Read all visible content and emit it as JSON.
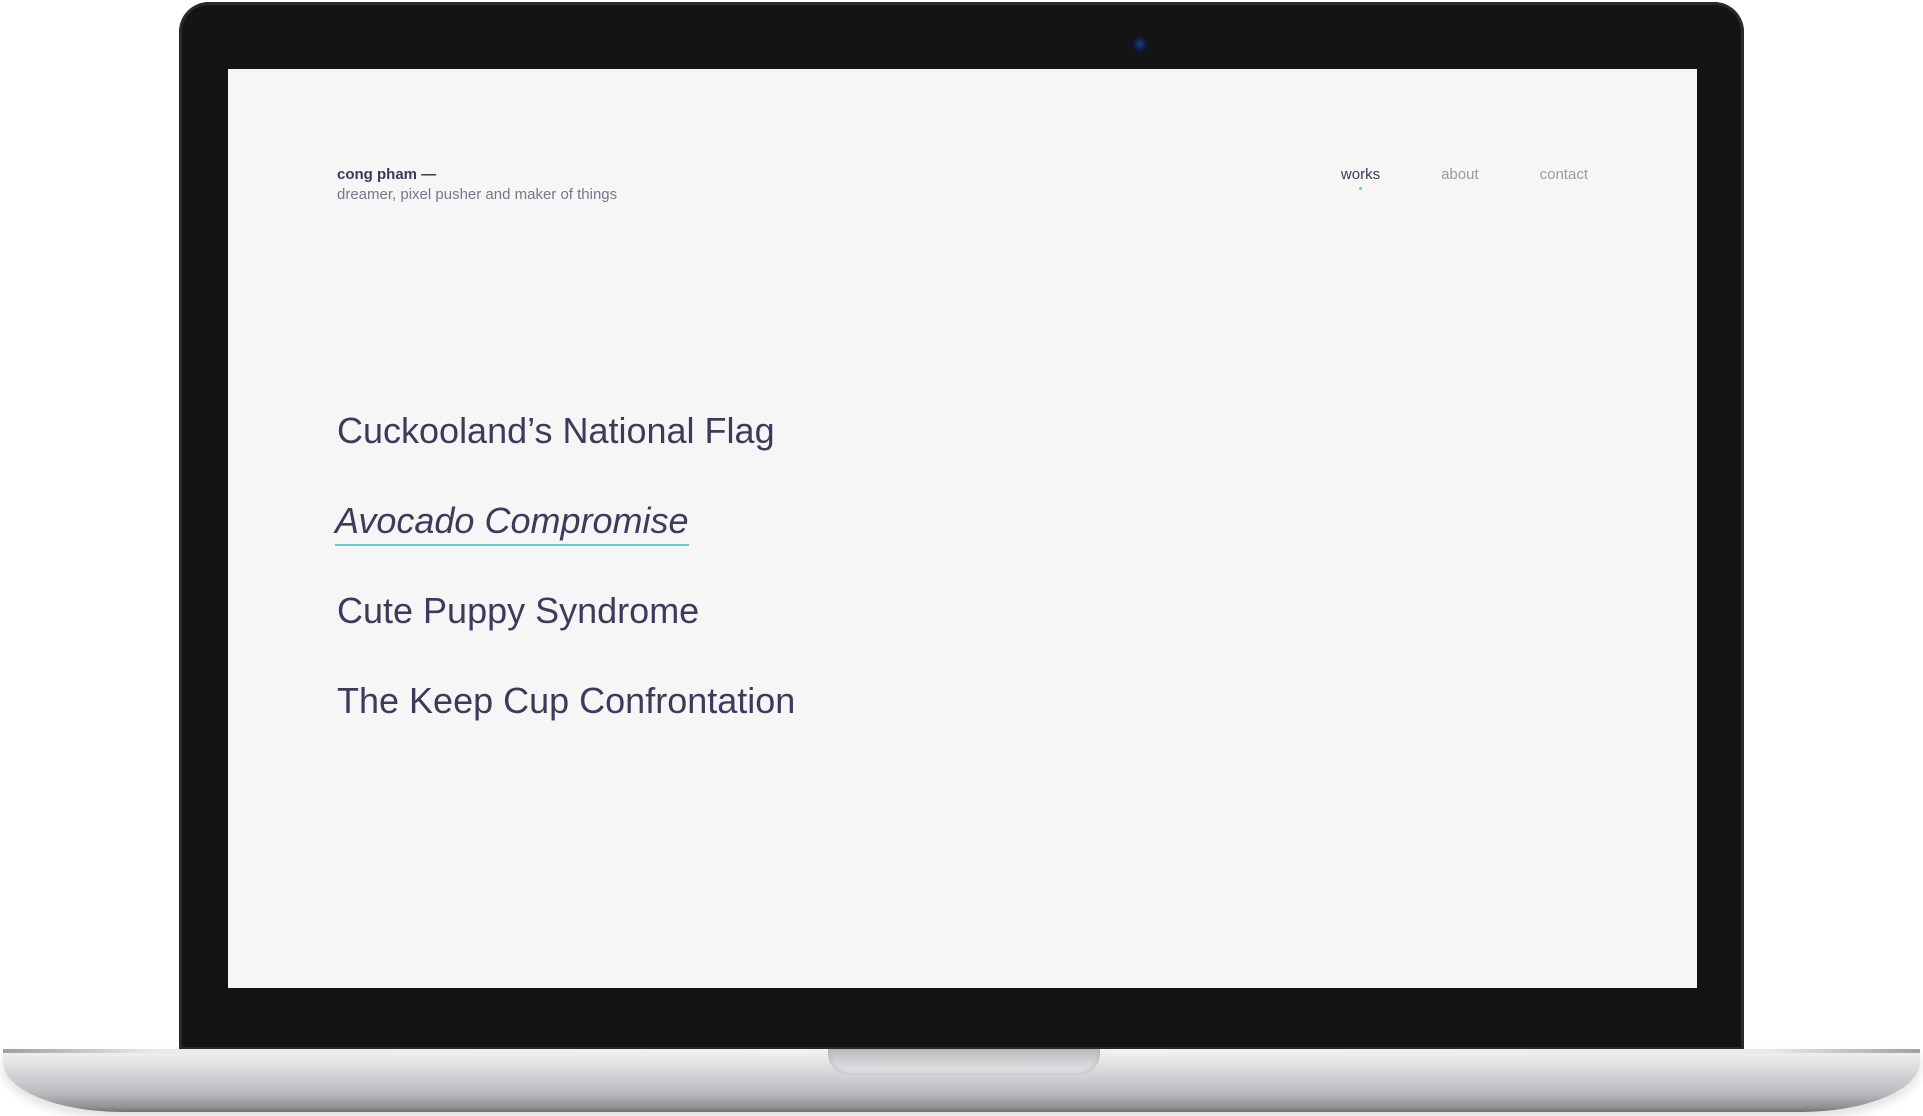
{
  "site": {
    "brand_name": "cong pham —",
    "tagline": "dreamer, pixel pusher and maker of things"
  },
  "nav": {
    "items": [
      {
        "label": "works",
        "active": true
      },
      {
        "label": "about",
        "active": false
      },
      {
        "label": "contact",
        "active": false
      }
    ]
  },
  "works": {
    "items": [
      {
        "title": "Cuckooland’s National Flag",
        "hovered": false
      },
      {
        "title": "Avocado Compromise",
        "hovered": true
      },
      {
        "title": "Cute Puppy Syndrome",
        "hovered": false
      },
      {
        "title": "The Keep Cup Confrontation",
        "hovered": false
      }
    ]
  },
  "colors": {
    "text_primary": "#3d3b5a",
    "text_muted": "#9a9aa8",
    "accent": "#4fd1c5",
    "screen_background": "#f6f6f6",
    "bezel": "#141414"
  }
}
